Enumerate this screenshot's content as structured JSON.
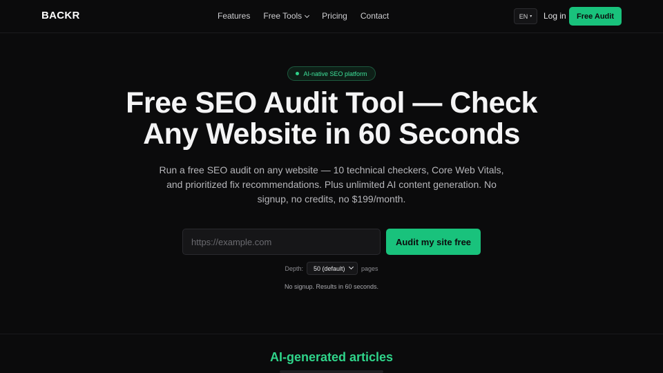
{
  "brand": {
    "logo": "BACKR",
    "accent_color": "#19c27c"
  },
  "nav": {
    "links": [
      "Features",
      "Free Tools",
      "Pricing",
      "Contact"
    ],
    "language": "EN",
    "login": "Log in",
    "cta": "Free Audit"
  },
  "hero": {
    "badge": "AI-native SEO platform",
    "headline_line1": "Free SEO Audit Tool — Check",
    "headline_line2": "Any Website in 60 Seconds",
    "subtitle": "Run a free SEO audit on any website — 10 technical checkers, Core Web Vitals, and prioritized fix recommendations. Plus unlimited AI content generation. No signup, no credits, no $199/month."
  },
  "audit_form": {
    "url_placeholder": "https://example.com",
    "url_value": "",
    "submit": "Audit my site free",
    "depth_label": "Depth:",
    "depth_value": "50 (default)",
    "depth_unit": "pages",
    "note": "No signup. Results in 60 seconds."
  },
  "next_section": {
    "title": "AI-generated articles"
  }
}
